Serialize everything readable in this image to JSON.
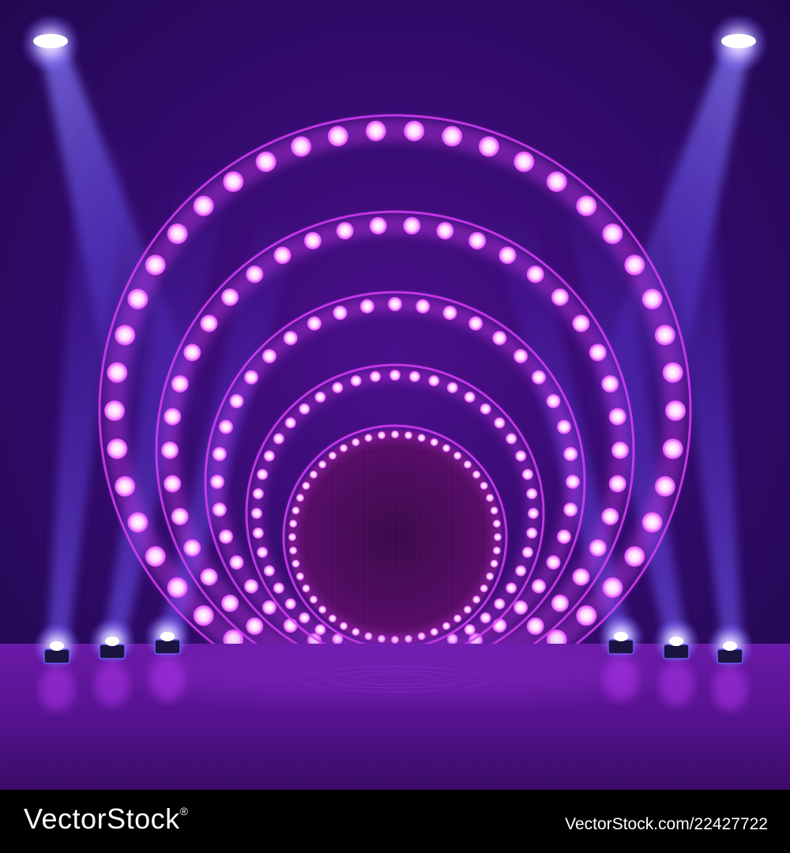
{
  "colors": {
    "background_top": "#2c0a5e",
    "background_mid": "#3a0d7a",
    "floor": "#5a1590",
    "ring_glow": "#e040ff",
    "bulb": "#ffd8ff",
    "beam": "#5f4cff"
  },
  "scene": {
    "rings": [
      {
        "name": "ring-1",
        "bulbs": 46
      },
      {
        "name": "ring-2",
        "bulbs": 42
      },
      {
        "name": "ring-3",
        "bulbs": 40
      },
      {
        "name": "ring-4",
        "bulbs": 44
      },
      {
        "name": "ring-5",
        "bulbs": 48
      }
    ],
    "spotlights": [
      "spotlight-top-left",
      "spotlight-top-right"
    ],
    "stage_lights": [
      "stage-light-1",
      "stage-light-2",
      "stage-light-3",
      "stage-light-4",
      "stage-light-5",
      "stage-light-6"
    ]
  },
  "footer": {
    "logo_text": "VectorStock",
    "logo_mark": "®",
    "image_id": "VectorStock.com/22427722"
  }
}
